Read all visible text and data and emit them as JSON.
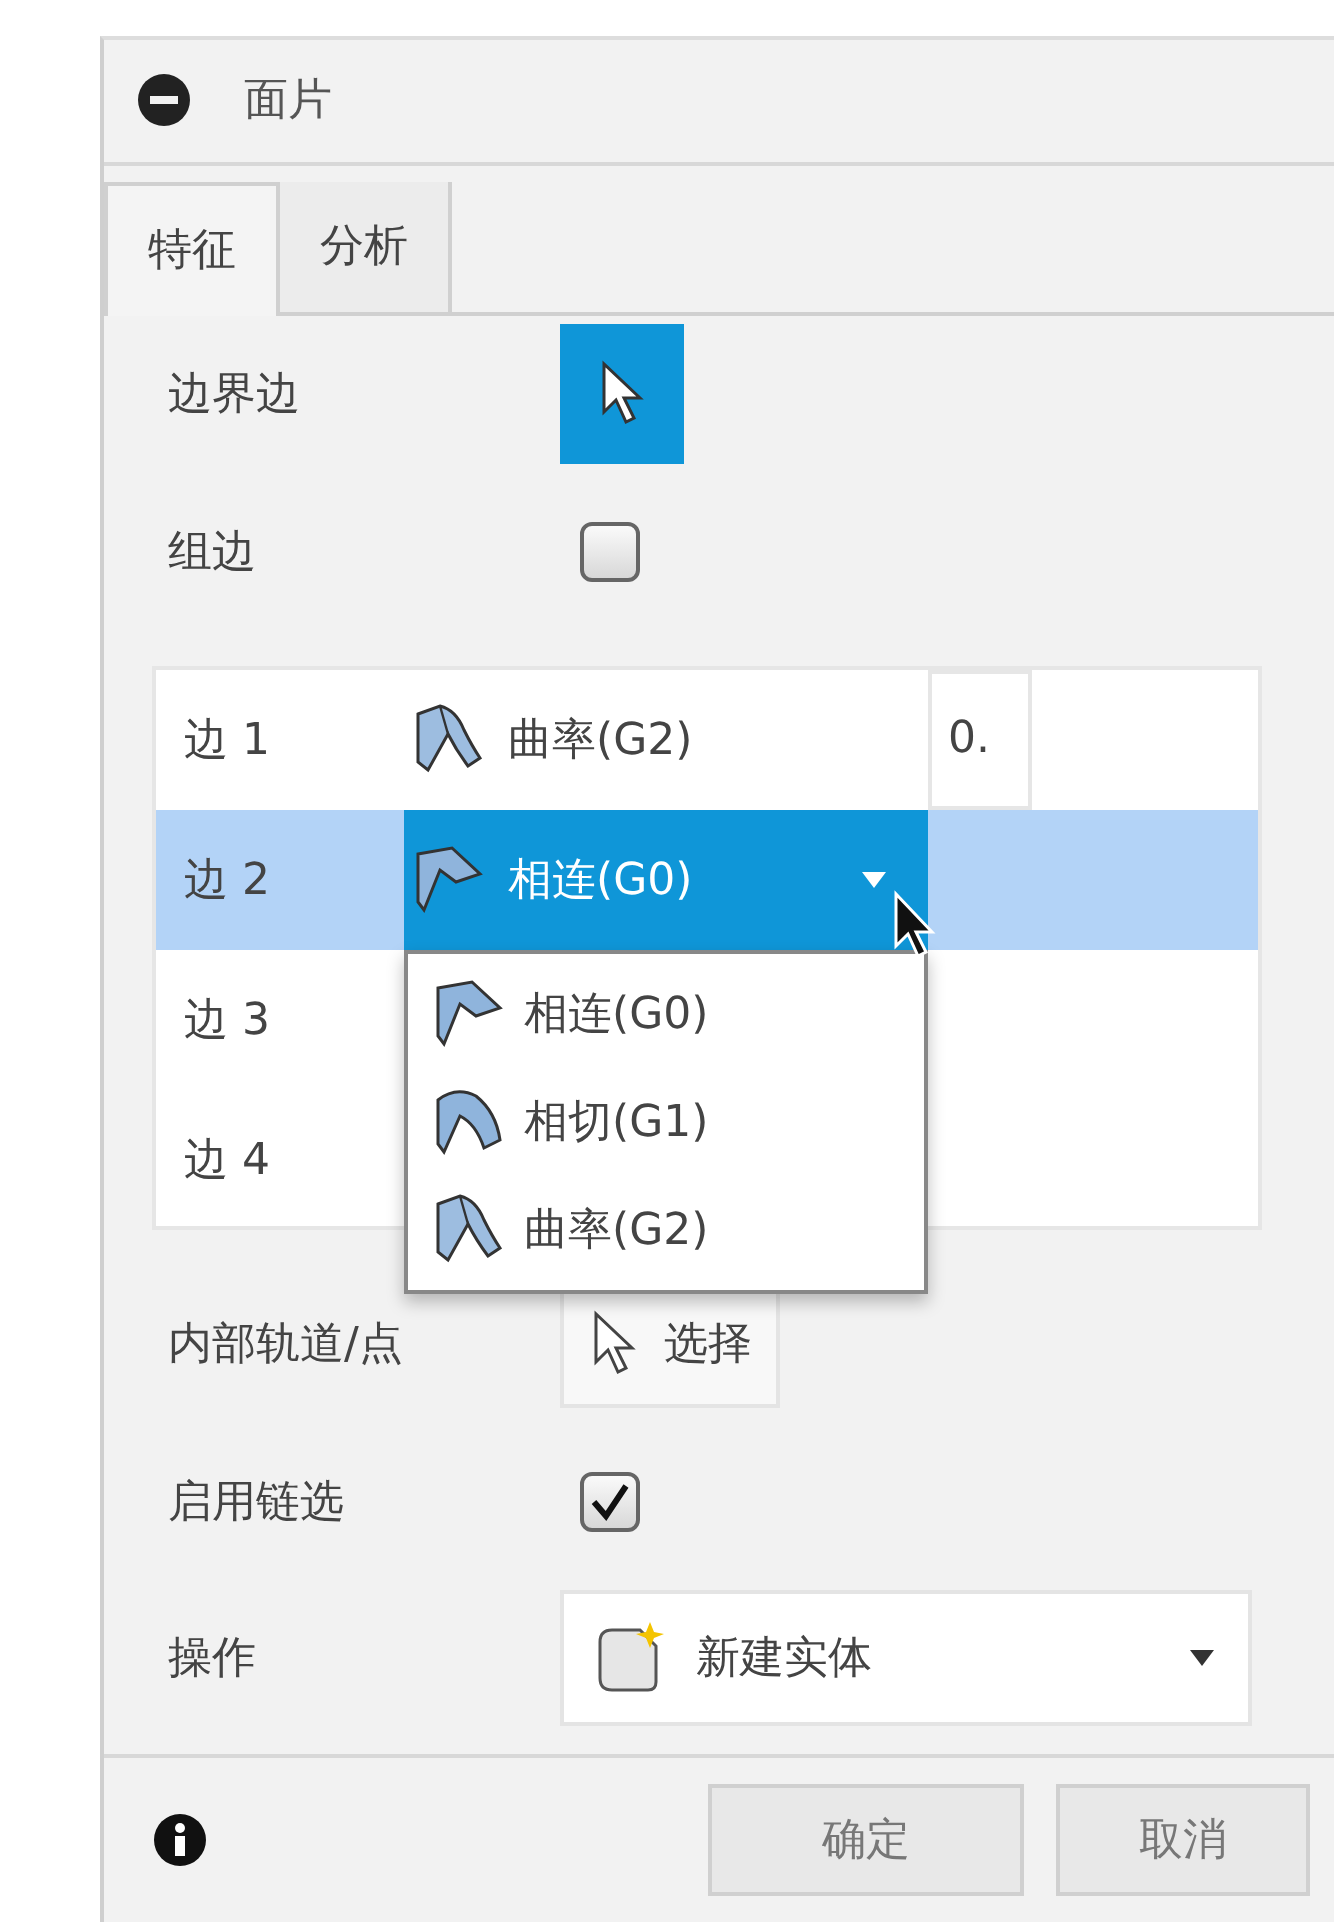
{
  "panel": {
    "title": "面片"
  },
  "tabs": [
    {
      "label": "特征",
      "selected": true
    },
    {
      "label": "分析",
      "selected": false
    }
  ],
  "fields": [
    {
      "kind": "select-button",
      "label": "边界边",
      "selected": true
    },
    {
      "kind": "checkbox",
      "label": "组边",
      "checked": false
    }
  ],
  "edges": [
    {
      "label": "边 1",
      "selected": false,
      "continuity": "曲率(G2)",
      "kind": "g2",
      "open": false,
      "value": "0."
    },
    {
      "label": "边 2",
      "selected": true,
      "continuity": "相连(G0)",
      "kind": "g0",
      "open": true
    },
    {
      "label": "边 3",
      "selected": false
    },
    {
      "label": "边 4",
      "selected": false
    }
  ],
  "dropdown": {
    "options": [
      {
        "label": "相连(G0)",
        "kind": "g0"
      },
      {
        "label": "相切(G1)",
        "kind": "g1"
      },
      {
        "label": "曲率(G2)",
        "kind": "g2"
      }
    ]
  },
  "fields2": [
    {
      "kind": "button",
      "label": "内部轨道/点",
      "button": "选择"
    },
    {
      "kind": "checkbox",
      "label": "启用链选",
      "checked": true
    },
    {
      "kind": "combo",
      "label": "操作",
      "value": "新建实体"
    }
  ],
  "buttons": [
    "确定",
    "取消"
  ]
}
